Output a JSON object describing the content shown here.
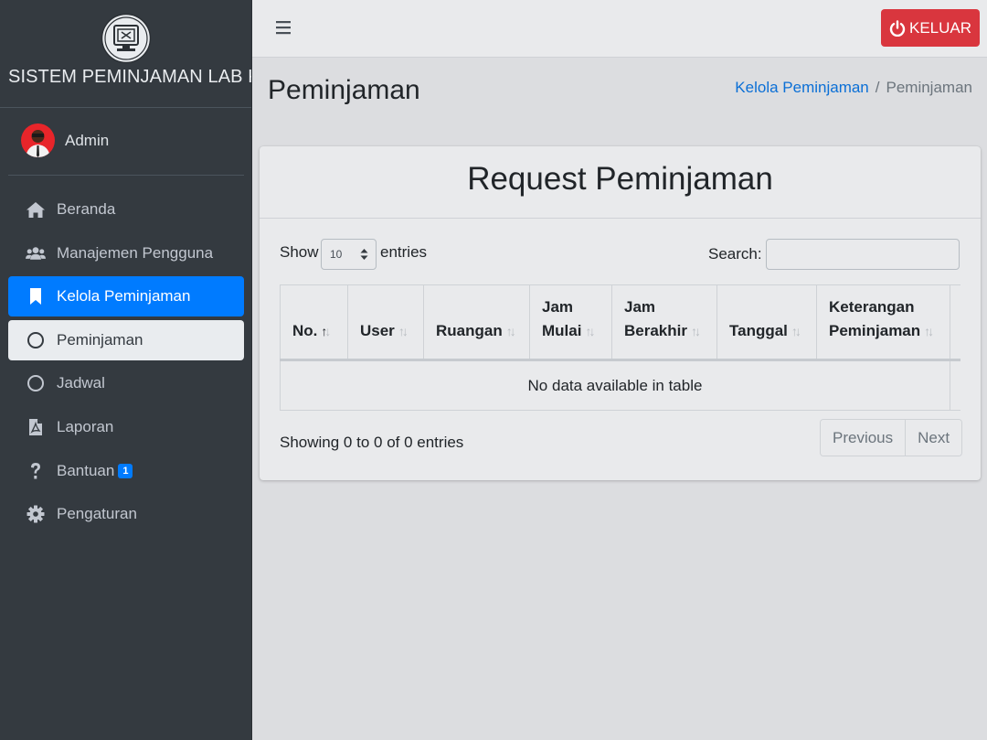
{
  "brand": {
    "title": "SISTEM PEMINJAMAN LAB KOMPUTER"
  },
  "user": {
    "name": "Admin"
  },
  "sidebar": {
    "items": [
      {
        "label": "Beranda",
        "icon": "home-icon"
      },
      {
        "label": "Manajemen Pengguna",
        "icon": "users-icon"
      },
      {
        "label": "Kelola Peminjaman",
        "icon": "bookmark-icon",
        "state": "active"
      },
      {
        "label": "Peminjaman",
        "icon": "circle-icon",
        "state": "sub-active"
      },
      {
        "label": "Jadwal",
        "icon": "circle-icon"
      },
      {
        "label": "Laporan",
        "icon": "file-pdf-icon"
      },
      {
        "label": "Bantuan",
        "icon": "question-icon",
        "badge": "1"
      },
      {
        "label": "Pengaturan",
        "icon": "gear-icon"
      }
    ]
  },
  "topbar": {
    "logout_label": "KELUAR"
  },
  "header": {
    "title": "Peminjaman",
    "breadcrumb": {
      "parent": "Kelola Peminjaman",
      "separator": "/",
      "current": "Peminjaman"
    }
  },
  "card": {
    "title": "Request Peminjaman"
  },
  "table_controls": {
    "show_label": "Show",
    "length_value": "10",
    "entries_label": "entries",
    "search_label": "Search:",
    "search_value": ""
  },
  "table": {
    "columns": [
      {
        "line1": "",
        "line2": "No."
      },
      {
        "line1": "",
        "line2": "User"
      },
      {
        "line1": "",
        "line2": "Ruangan"
      },
      {
        "line1": "Jam",
        "line2": "Mulai"
      },
      {
        "line1": "Jam",
        "line2": "Berakhir"
      },
      {
        "line1": "",
        "line2": "Tanggal"
      },
      {
        "line1": "Keterangan",
        "line2": "Peminjaman"
      },
      {
        "line1": "",
        "line2": ""
      }
    ],
    "empty_message": "No data available in table"
  },
  "footer": {
    "info": "Showing 0 to 0 of 0 entries",
    "previous_label": "Previous",
    "next_label": "Next"
  },
  "colors": {
    "sidebar_bg": "#343a40",
    "active_blue": "#007bff",
    "danger_red": "#d9363e",
    "link_blue": "#0b6fd6",
    "content_bg": "#dcdde0"
  }
}
